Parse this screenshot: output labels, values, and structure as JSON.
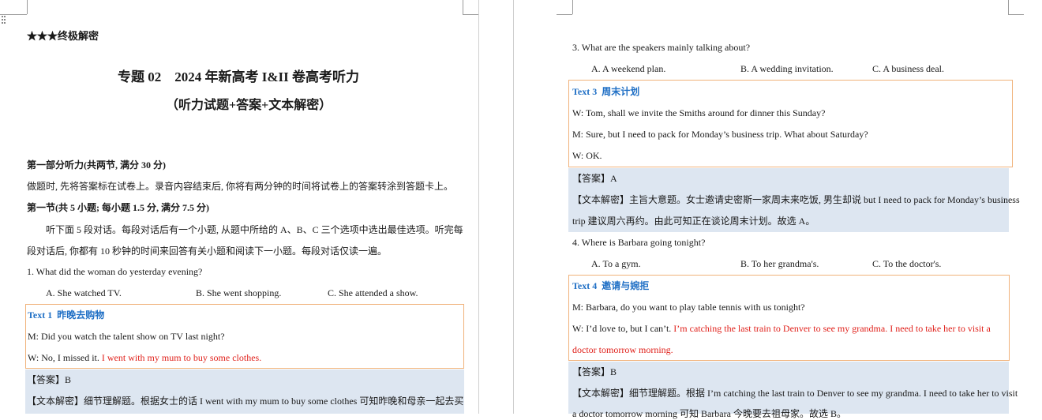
{
  "left": {
    "stars": "★★★",
    "tag": "终极解密",
    "title": "专题 02　2024 年新高考 I&II 卷高考听力",
    "subtitle": "（听力试题+答案+文本解密）",
    "part1": "第一部分听力(共两节, 满分 30 分)",
    "instr1": "做题时, 先将答案标在试卷上。录音内容结束后, 你将有两分钟的时间将试卷上的答案转涂到答题卡上。",
    "section1": "第一节(共 5 小题; 每小题 1.5 分, 满分 7.5 分)",
    "instr2a": "听下面 5 段对话。每段对话后有一个小题, 从题中所给的 A、B、C 三个选项中选出最佳选项。听完每",
    "instr2b": "段对话后, 你都有 10 秒钟的时间来回答有关小题和阅读下一小题。每段对话仅读一遍。",
    "q1": "1. What did the woman do yesterday evening?",
    "q1_options": [
      "A. She watched TV.",
      "B. She went shopping.",
      "C. She attended a show."
    ],
    "text1_label": "Text 1",
    "text1_title": "昨晚去购物",
    "text1_m": "M: Did you watch the talent show on TV last night?",
    "text1_w_plain": "W: No, I missed it. ",
    "text1_w_red": "I went with my mum to buy some clothes.",
    "answer1": "【答案】B",
    "analysis1": "【文本解密】细节理解题。根据女士的话 I went with my mum to buy some clothes 可知昨晚和母亲一起去买"
  },
  "right": {
    "q3": "3. What are the speakers mainly talking about?",
    "q3_options": [
      "A. A weekend plan.",
      "B. A wedding invitation.",
      "C. A business deal."
    ],
    "text3_label": "Text 3",
    "text3_title": "周末计划",
    "text3_w1": "W: Tom, shall we invite the Smiths around for dinner this Sunday?",
    "text3_m": "M: Sure, but I need to pack for Monday’s business trip. What about Saturday?",
    "text3_w2": "W: OK.",
    "answer3": "【答案】A",
    "analysis3a": "【文本解密】主旨大意题。女士邀请史密斯一家周末来吃饭, 男生却说 but I need to pack for Monday’s business",
    "analysis3b": "trip 建议周六再约。由此可知正在谈论周末计划。故选 A。",
    "q4": "4. Where is Barbara going tonight?",
    "q4_options": [
      "A. To a gym.",
      "B. To her grandma's.",
      "C. To the doctor's."
    ],
    "text4_label": "Text 4",
    "text4_title": "邀请与婉拒",
    "text4_m": "M: Barbara, do you want to play table tennis with us tonight?",
    "text4_w_plain": "W: I’d love to, but I can’t. ",
    "text4_w_red1": "I’m catching the last train to Denver to see my grandma. I need to take her to visit a",
    "text4_w_red2": "doctor tomorrow morning.",
    "answer4": "【答案】B",
    "analysis4a": "【文本解密】细节理解题。根据 I’m catching the last train to Denver to see my grandma. I need to take her to visit",
    "analysis4b": "a doctor tomorrow morning 可知 Barbara 今晚要去祖母家。故选 B。"
  }
}
